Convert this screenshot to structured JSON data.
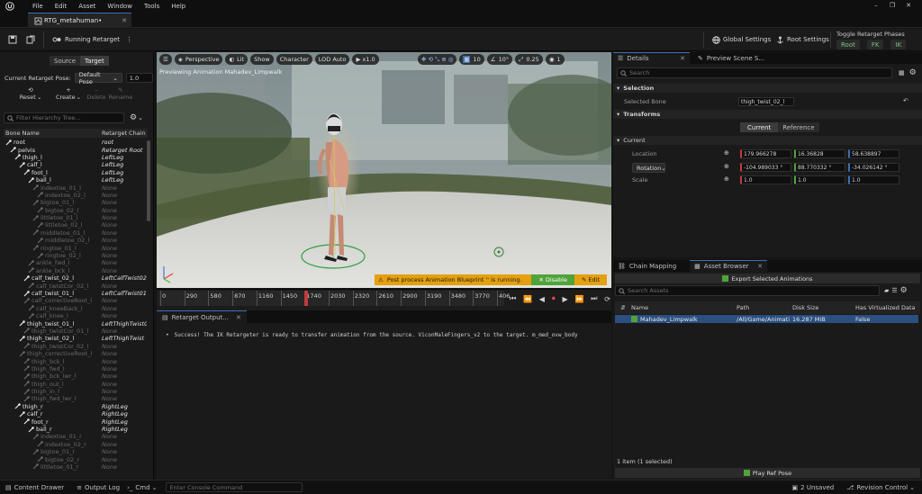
{
  "menu": [
    "File",
    "Edit",
    "Asset",
    "Window",
    "Tools",
    "Help"
  ],
  "window_tab": "RTG_metahuman•",
  "toolbar": {
    "running_label": "Running Retarget",
    "global_settings": "Global Settings",
    "root_settings": "Root Settings",
    "toggle_phases_label": "Toggle Retarget Phases",
    "phases": [
      "Root",
      "FK",
      "IK"
    ]
  },
  "left_panel": {
    "tabs": [
      "Source",
      "Target"
    ],
    "active_tab": "Target",
    "retarget_pose_label": "Current Retarget Pose:",
    "retarget_pose_value": "Default Pose",
    "retarget_pose_scale": "1.0",
    "tools": [
      "Reset",
      "Create",
      "Delete",
      "Rename"
    ],
    "search_placeholder": "Filter Hierarchy Tree...",
    "columns": [
      "Bone Name",
      "Retarget Chain"
    ]
  },
  "tree": [
    {
      "name": "root",
      "chain": "root",
      "depth": 0,
      "active": true
    },
    {
      "name": "pelvis",
      "chain": "Retarget Root",
      "depth": 1,
      "active": true
    },
    {
      "name": "thigh_l",
      "chain": "LeftLeg",
      "depth": 2,
      "active": true
    },
    {
      "name": "calf_l",
      "chain": "LeftLeg",
      "depth": 3,
      "active": true
    },
    {
      "name": "foot_l",
      "chain": "LeftLeg",
      "depth": 4,
      "active": true
    },
    {
      "name": "ball_l",
      "chain": "LeftLeg",
      "depth": 5,
      "active": true
    },
    {
      "name": "indextoe_01_l",
      "chain": "None",
      "depth": 6,
      "active": false
    },
    {
      "name": "indextoe_02_l",
      "chain": "None",
      "depth": 7,
      "active": false
    },
    {
      "name": "bigtoe_01_l",
      "chain": "None",
      "depth": 6,
      "active": false
    },
    {
      "name": "bigtoe_02_l",
      "chain": "None",
      "depth": 7,
      "active": false
    },
    {
      "name": "littletoe_01_l",
      "chain": "None",
      "depth": 6,
      "active": false
    },
    {
      "name": "littletoe_02_l",
      "chain": "None",
      "depth": 7,
      "active": false
    },
    {
      "name": "middletoe_01_l",
      "chain": "None",
      "depth": 6,
      "active": false
    },
    {
      "name": "middletoe_02_l",
      "chain": "None",
      "depth": 7,
      "active": false
    },
    {
      "name": "ringtoe_01_l",
      "chain": "None",
      "depth": 6,
      "active": false
    },
    {
      "name": "ringtoe_02_l",
      "chain": "None",
      "depth": 7,
      "active": false
    },
    {
      "name": "ankle_fwd_l",
      "chain": "None",
      "depth": 5,
      "active": false
    },
    {
      "name": "ankle_bck_l",
      "chain": "None",
      "depth": 5,
      "active": false
    },
    {
      "name": "calf_twist_02_l",
      "chain": "LeftCalfTwist02",
      "depth": 4,
      "active": true
    },
    {
      "name": "calf_twistCor_02_l",
      "chain": "None",
      "depth": 5,
      "active": false
    },
    {
      "name": "calf_twist_01_l",
      "chain": "LeftCalfTwist01",
      "depth": 4,
      "active": true
    },
    {
      "name": "calf_correctiveRoot_l",
      "chain": "None",
      "depth": 4,
      "active": false
    },
    {
      "name": "calf_kneeBack_l",
      "chain": "None",
      "depth": 5,
      "active": false
    },
    {
      "name": "calf_knee_l",
      "chain": "None",
      "depth": 5,
      "active": false
    },
    {
      "name": "thigh_twist_01_l",
      "chain": "LeftThighTwist01",
      "depth": 3,
      "active": true
    },
    {
      "name": "thigh_twistCor_01_l",
      "chain": "None",
      "depth": 4,
      "active": false
    },
    {
      "name": "thigh_twist_02_l",
      "chain": "LeftThighTwist",
      "depth": 3,
      "active": true
    },
    {
      "name": "thigh_twistCor_02_l",
      "chain": "None",
      "depth": 4,
      "active": false
    },
    {
      "name": "thigh_correctiveRoot_l",
      "chain": "None",
      "depth": 3,
      "active": false
    },
    {
      "name": "thigh_bck_l",
      "chain": "None",
      "depth": 4,
      "active": false
    },
    {
      "name": "thigh_fwd_l",
      "chain": "None",
      "depth": 4,
      "active": false
    },
    {
      "name": "thigh_bck_lwr_l",
      "chain": "None",
      "depth": 4,
      "active": false
    },
    {
      "name": "thigh_out_l",
      "chain": "None",
      "depth": 4,
      "active": false
    },
    {
      "name": "thigh_in_l",
      "chain": "None",
      "depth": 4,
      "active": false
    },
    {
      "name": "thigh_fwd_lwr_l",
      "chain": "None",
      "depth": 4,
      "active": false
    },
    {
      "name": "thigh_r",
      "chain": "RightLeg",
      "depth": 2,
      "active": true
    },
    {
      "name": "calf_r",
      "chain": "RightLeg",
      "depth": 3,
      "active": true
    },
    {
      "name": "foot_r",
      "chain": "RightLeg",
      "depth": 4,
      "active": true
    },
    {
      "name": "ball_r",
      "chain": "RightLeg",
      "depth": 5,
      "active": true
    },
    {
      "name": "indextoe_01_r",
      "chain": "None",
      "depth": 6,
      "active": false
    },
    {
      "name": "indextoe_02_r",
      "chain": "None",
      "depth": 7,
      "active": false
    },
    {
      "name": "bigtoe_01_r",
      "chain": "None",
      "depth": 6,
      "active": false
    },
    {
      "name": "bigtoe_02_r",
      "chain": "None",
      "depth": 7,
      "active": false
    },
    {
      "name": "littletoe_01_r",
      "chain": "None",
      "depth": 6,
      "active": false
    }
  ],
  "viewport": {
    "perspective": "Perspective",
    "lit": "Lit",
    "show": "Show",
    "character": "Character",
    "lod": "LOD Auto",
    "play_rate": "x1.0",
    "grid_snap": "10",
    "rot_snap": "10°",
    "scale_snap": "0.25",
    "camera_speed": "1",
    "preview_text": "Previewing Animation Mahadev_Limpwalk",
    "warning_text": "Post process Animation Blueprint '' is running.",
    "disable_label": "Disable",
    "edit_label": "Edit"
  },
  "timeline": {
    "ticks": [
      "0",
      "290",
      "580",
      "870",
      "1160",
      "1450",
      "1740",
      "2030",
      "2320",
      "2610",
      "2900",
      "3190",
      "3480",
      "3770",
      "406"
    ],
    "playhead_value": 1740,
    "playhead_max": 4060
  },
  "output": {
    "tab": "Retarget Output...",
    "message": "Success! The IK Retargeter is ready to transfer animation from the source. ViconMaleFingers_v2 to the target. m_med_ovw_body"
  },
  "details": {
    "tabs": [
      "Details",
      "Preview Scene S..."
    ],
    "search_placeholder": "Search",
    "selection_header": "Selection",
    "selected_bone_label": "Selected Bone",
    "selected_bone_value": "thigh_twist_02_l",
    "transforms_header": "Transforms",
    "transform_modes": [
      "Current",
      "Reference"
    ],
    "current_header": "Current",
    "location_label": "Location",
    "location": [
      "179.966278",
      "16.36828",
      "58.638897"
    ],
    "rotation_label": "Rotation",
    "rotation": [
      "-104.989033 °",
      "88.770332 °",
      "-34.026142 °"
    ],
    "scale_label": "Scale",
    "scale": [
      "1.0",
      "1.0",
      "1.0"
    ]
  },
  "assets": {
    "tabs": [
      "Chain Mapping",
      "Asset Browser"
    ],
    "export_label": "Export Selected Animations",
    "search_placeholder": "Search Assets",
    "columns": [
      "Name",
      "Path",
      "Disk Size",
      "Has Virtualized Data"
    ],
    "rows": [
      {
        "name": "Mahadev_Limpwalk",
        "path": "/All/Game/Animati",
        "size": "16.287 MiB",
        "virtualized": "False"
      }
    ],
    "footer": "1 item (1 selected)",
    "play_ref_pose": "Play Ref Pose"
  },
  "statusbar": {
    "content_drawer": "Content Drawer",
    "output_log": "Output Log",
    "cmd": "Cmd",
    "console_placeholder": "Enter Console Command",
    "unsaved": "2 Unsaved",
    "revision": "Revision Control"
  },
  "colors": {
    "accent": "#3d6fb5",
    "warning": "#e5a00d",
    "disable_green": "#4fa33a",
    "phase_green": "#7fc57f",
    "selection": "#2a4f80"
  }
}
